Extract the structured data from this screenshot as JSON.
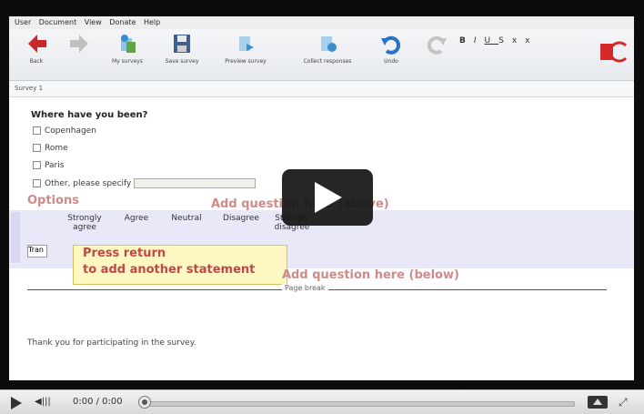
{
  "menu": [
    "User",
    "Document",
    "View",
    "Donate",
    "Help"
  ],
  "toolbar": [
    {
      "label": "Back",
      "icon": "back-arrow-icon",
      "color": "#c8272b"
    },
    {
      "label": "",
      "icon": "forward-arrow-icon",
      "color": "#b8b8b8"
    },
    {
      "label": "My surveys",
      "icon": "my-surveys-icon",
      "color": "#3a8ecc"
    },
    {
      "label": "Save survey",
      "icon": "save-icon",
      "color": "#3f5f8f"
    },
    {
      "label": "Preview survey",
      "icon": "preview-icon",
      "color": "#3a8ecc"
    },
    {
      "label": "Collect responses",
      "icon": "collect-responses-icon",
      "color": "#3a8ecc"
    },
    {
      "label": "Undo",
      "icon": "undo-icon",
      "color": "#2a72c8"
    },
    {
      "label": "",
      "icon": "redo-icon",
      "color": "#b8b8b8"
    }
  ],
  "tab": "Survey 1",
  "question": {
    "title": "Where have you been?",
    "options": [
      "Copenhagen",
      "Rome",
      "Paris",
      "Other, please specify"
    ]
  },
  "options_label": "Options",
  "add_above": "Add question here (above)",
  "add_below": "Add question here (below)",
  "matrix": {
    "columns": [
      "Strongly agree",
      "Agree",
      "Neutral",
      "Disagree",
      "Strongly disagree"
    ],
    "row_input": "Tran"
  },
  "tooltip": [
    "Press return",
    "to add another statement"
  ],
  "page_break": "Page break",
  "thanks": "Thank you for participating in the survey.",
  "player": {
    "time": "0:00 / 0:00",
    "progress": 0
  }
}
